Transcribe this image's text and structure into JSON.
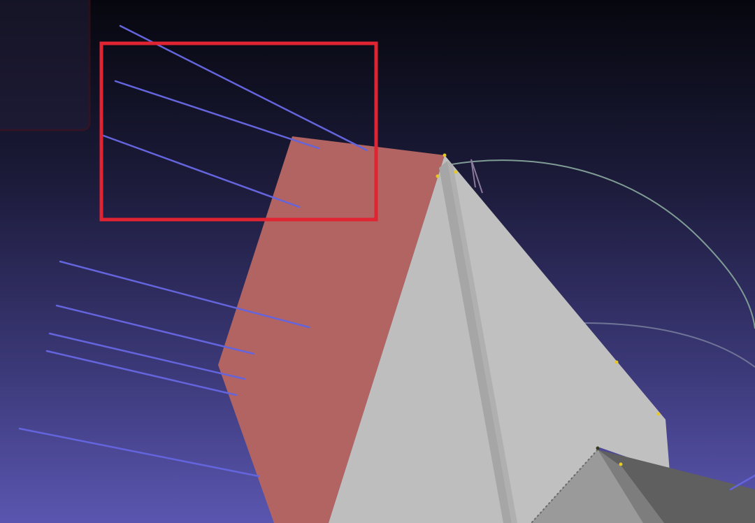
{
  "viewport": {
    "background_top": "#06070e",
    "background_bottom": "#5a56b0"
  },
  "colors": {
    "highlight_box": "#e02432",
    "selected_face": "#b26462",
    "mesh_light": "#bebebe",
    "mesh_mid": "#a7a7a7",
    "mesh_dark": "#5e5e5e",
    "normals": "#6464dc",
    "vertex_points": "#e6c828",
    "curve_line": "#7f9c95"
  }
}
